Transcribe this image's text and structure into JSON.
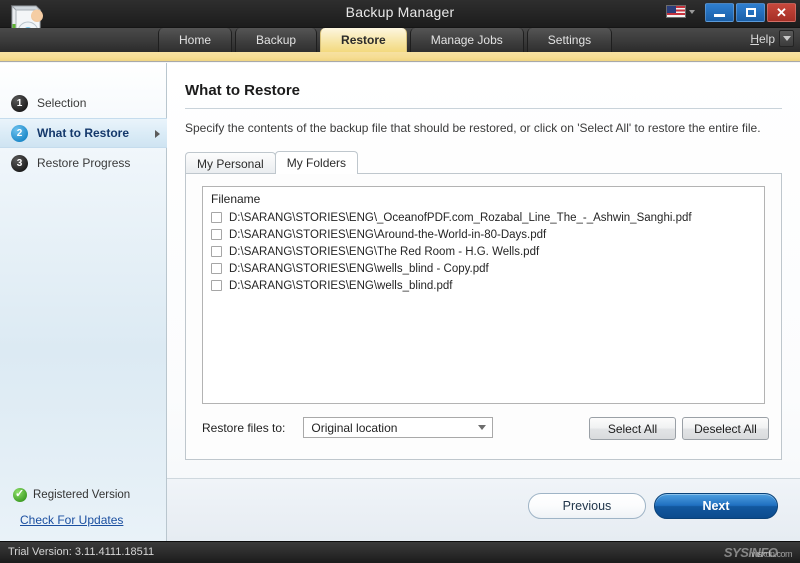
{
  "window": {
    "title": "Backup Manager",
    "app_icon": "backup-restore-icon",
    "flag_icon": "us-flag-icon",
    "minimize_label": "",
    "maximize_label": "",
    "close_label": "✕"
  },
  "nav": {
    "tabs": [
      {
        "label": "Home",
        "active": false
      },
      {
        "label": "Backup",
        "active": false
      },
      {
        "label": "Restore",
        "active": true
      },
      {
        "label": "Manage Jobs",
        "active": false
      },
      {
        "label": "Settings",
        "active": false
      }
    ],
    "help_label": "Help"
  },
  "sidebar": {
    "steps": [
      {
        "num": "1",
        "label": "Selection",
        "active": false
      },
      {
        "num": "2",
        "label": "What to Restore",
        "active": true
      },
      {
        "num": "3",
        "label": "Restore Progress",
        "active": false
      }
    ],
    "registered_label": "Registered Version",
    "updates_link": "Check For Updates"
  },
  "main": {
    "page_title": "What to Restore",
    "description": "Specify the contents of the backup file that should be restored, or click on 'Select All' to restore the entire file.",
    "inner_tabs": [
      {
        "label": "My Personal",
        "active": false
      },
      {
        "label": "My Folders",
        "active": true
      }
    ],
    "list": {
      "column_header": "Filename",
      "rows": [
        {
          "checked": false,
          "filename": "D:\\SARANG\\STORIES\\ENG\\_OceanofPDF.com_Rozabal_Line_The_-_Ashwin_Sanghi.pdf"
        },
        {
          "checked": false,
          "filename": "D:\\SARANG\\STORIES\\ENG\\Around-the-World-in-80-Days.pdf"
        },
        {
          "checked": false,
          "filename": "D:\\SARANG\\STORIES\\ENG\\The Red Room - H.G. Wells.pdf"
        },
        {
          "checked": false,
          "filename": "D:\\SARANG\\STORIES\\ENG\\wells_blind - Copy.pdf"
        },
        {
          "checked": false,
          "filename": "D:\\SARANG\\STORIES\\ENG\\wells_blind.pdf"
        }
      ]
    },
    "restore_to_label": "Restore files to:",
    "restore_to_value": "Original location",
    "select_all_label": "Select All",
    "deselect_all_label": "Deselect All"
  },
  "footer": {
    "previous_label": "Previous",
    "next_label": "Next"
  },
  "status": {
    "trial_text": "Trial Version: 3.11.4111.18511",
    "watermark": "SYSINFO",
    "watermark_sub": "wsxdn.com"
  },
  "colors": {
    "accent_yellow": "#f3d97e",
    "accent_blue": "#1f6fc0",
    "sidebar_blue": "#dceaf3",
    "close_red": "#c8483c"
  }
}
